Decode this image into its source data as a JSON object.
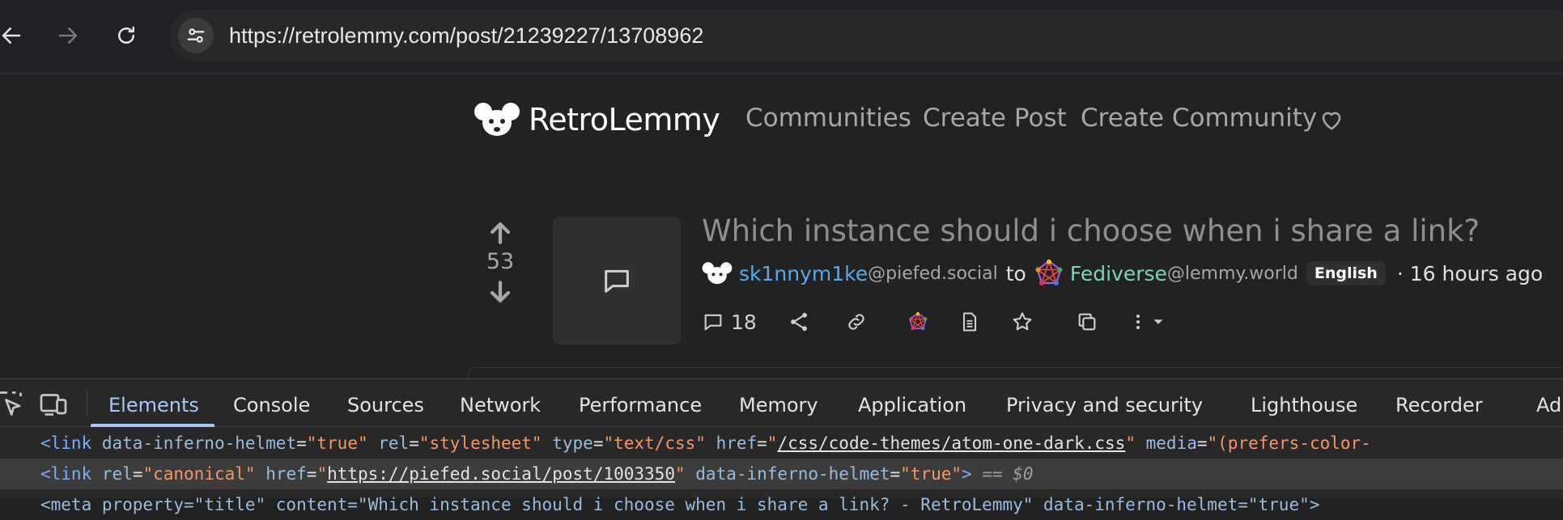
{
  "browser": {
    "url": "https://retrolemmy.com/post/21239227/13708962",
    "icons": [
      "back-arrow-icon",
      "forward-arrow-icon",
      "reload-icon",
      "site-settings-icon"
    ]
  },
  "site": {
    "name": "RetroLemmy",
    "nav": [
      "Communities",
      "Create Post",
      "Create Community"
    ]
  },
  "post": {
    "title": "Which instance should i choose when i share a link?",
    "score": "53",
    "author": "sk1nnym1ke",
    "author_instance": "@piefed.social",
    "to_word": "to",
    "community": "Fediverse",
    "community_instance": "@lemmy.world",
    "language": "English",
    "time": "· 16 hours ago",
    "comment_count": "18"
  },
  "colors": {
    "author": "#5aa9e6",
    "community": "#7fd3b4",
    "devtools_active": "#a8c7fa"
  },
  "devtools": {
    "tabs": [
      "Elements",
      "Console",
      "Sources",
      "Network",
      "Performance",
      "Memory",
      "Application",
      "Privacy and security",
      "Lighthouse",
      "Recorder",
      "Ad"
    ],
    "line1": {
      "open": "<link",
      "a1": "data-inferno-helmet",
      "v1": "\"true\"",
      "a2": "rel",
      "v2": "\"stylesheet\"",
      "a3": "type",
      "v3": "\"text/css\"",
      "a4": "href",
      "q1": "\"",
      "v4": "/css/code-themes/atom-one-dark.css",
      "q2": "\"",
      "a5": "media",
      "v5": "\"(prefers-color-"
    },
    "line2": {
      "open": "<link",
      "a1": "rel",
      "v1": "\"canonical\"",
      "a2": "href",
      "q1": "\"",
      "v2": "https://piefed.social/post/1003350",
      "q2": "\"",
      "a3": "data-inferno-helmet",
      "v3": "\"true\"",
      "close": ">",
      "dollar": "== $0"
    },
    "line3": {
      "text": "<meta property=\"title\" content=\"Which instance should i choose when i share a link? - RetroLemmy\" data-inferno-helmet=\"true\">"
    }
  }
}
